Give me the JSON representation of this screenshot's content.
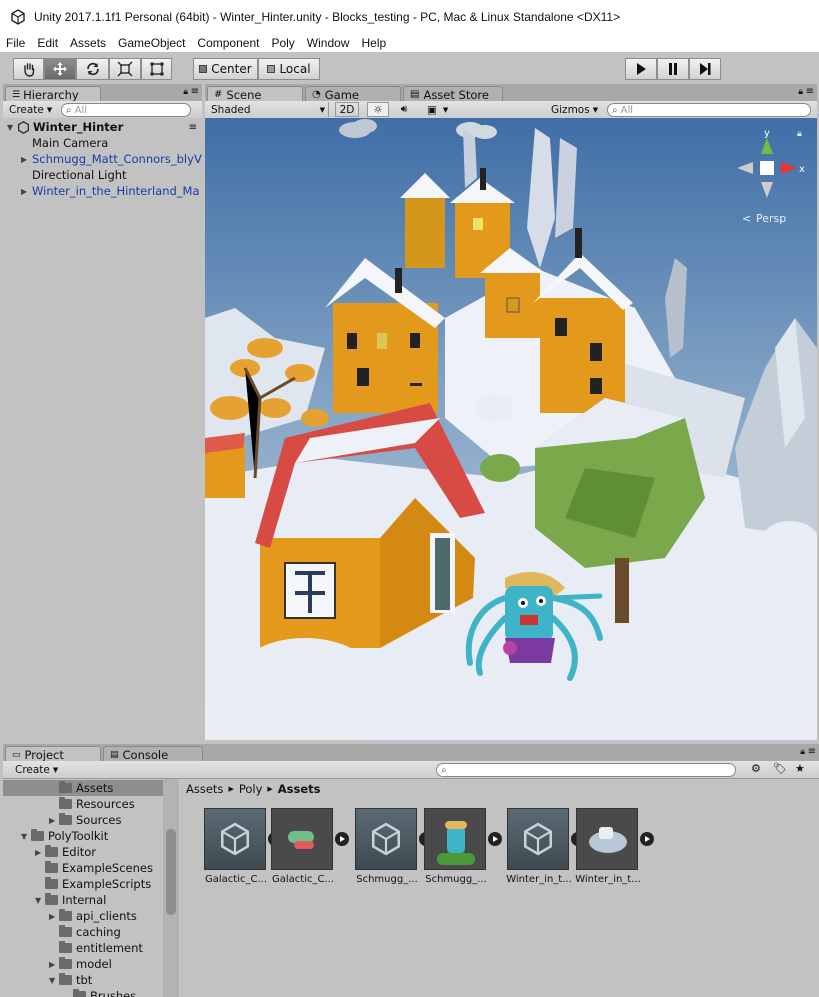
{
  "window": {
    "title": "Unity 2017.1.1f1 Personal (64bit) - Winter_Hinter.unity - Blocks_testing - PC, Mac & Linux Standalone <DX11>"
  },
  "menu": [
    "File",
    "Edit",
    "Assets",
    "GameObject",
    "Component",
    "Poly",
    "Window",
    "Help"
  ],
  "toolbar": {
    "tools": [
      "hand-tool",
      "move-tool",
      "rotate-tool",
      "scale-tool",
      "rect-tool"
    ],
    "pivot": "Center",
    "space": "Local",
    "playback": [
      "play",
      "pause",
      "step"
    ]
  },
  "hierarchy": {
    "tab": "Hierarchy",
    "create": "Create",
    "search_placeholder": "All",
    "scene": "Winter_Hinter",
    "items": [
      {
        "label": "Main Camera",
        "prefab": false,
        "expandable": false
      },
      {
        "label": "Schmugg_Matt_Connors_blyV",
        "prefab": true,
        "expandable": true
      },
      {
        "label": "Directional Light",
        "prefab": false,
        "expandable": false
      },
      {
        "label": "Winter_in_the_Hinterland_Ma",
        "prefab": true,
        "expandable": true
      }
    ]
  },
  "scene_view": {
    "tabs": [
      "Scene",
      "Game",
      "Asset Store"
    ],
    "active_tab": "Scene",
    "shading": "Shaded",
    "mode_2d": "2D",
    "gizmos": "Gizmos",
    "search_placeholder": "All",
    "gizmo_axes": {
      "y": "y",
      "x": "x"
    },
    "projection": "Persp"
  },
  "project": {
    "tabs": [
      "Project",
      "Console"
    ],
    "create": "Create",
    "breadcrumb": [
      "Assets",
      "Poly",
      "Assets"
    ],
    "tree": [
      {
        "label": "Assets",
        "depth": 2,
        "expander": "",
        "selected": true
      },
      {
        "label": "Resources",
        "depth": 2,
        "expander": "",
        "selected": false
      },
      {
        "label": "Sources",
        "depth": 2,
        "expander": "▶",
        "selected": false
      },
      {
        "label": "PolyToolkit",
        "depth": 0,
        "expander": "▼",
        "selected": false
      },
      {
        "label": "Editor",
        "depth": 1,
        "expander": "▶",
        "selected": false
      },
      {
        "label": "ExampleScenes",
        "depth": 1,
        "expander": "",
        "selected": false
      },
      {
        "label": "ExampleScripts",
        "depth": 1,
        "expander": "",
        "selected": false
      },
      {
        "label": "Internal",
        "depth": 1,
        "expander": "▼",
        "selected": false
      },
      {
        "label": "api_clients",
        "depth": 2,
        "expander": "▶",
        "selected": false
      },
      {
        "label": "caching",
        "depth": 2,
        "expander": "",
        "selected": false
      },
      {
        "label": "entitlement",
        "depth": 2,
        "expander": "",
        "selected": false
      },
      {
        "label": "model",
        "depth": 2,
        "expander": "▶",
        "selected": false
      },
      {
        "label": "tbt",
        "depth": 2,
        "expander": "▼",
        "selected": false
      },
      {
        "label": "Brushes",
        "depth": 3,
        "expander": "",
        "selected": false
      }
    ],
    "assets": [
      {
        "label": "Galactic_C...",
        "thumb": "unity-prefab-icon"
      },
      {
        "label": "Galactic_C...",
        "thumb": "ship-model-thumbnail"
      },
      {
        "label": "Schmugg_...",
        "thumb": "unity-prefab-icon"
      },
      {
        "label": "Schmugg_...",
        "thumb": "character-model-thumbnail"
      },
      {
        "label": "Winter_in_t...",
        "thumb": "unity-prefab-icon"
      },
      {
        "label": "Winter_in_t...",
        "thumb": "scene-model-thumbnail"
      }
    ]
  },
  "colors": {
    "editor_bg": "#c2c2c2",
    "prefab_text": "#1a3aa8",
    "selection": "#8e8e8e"
  }
}
